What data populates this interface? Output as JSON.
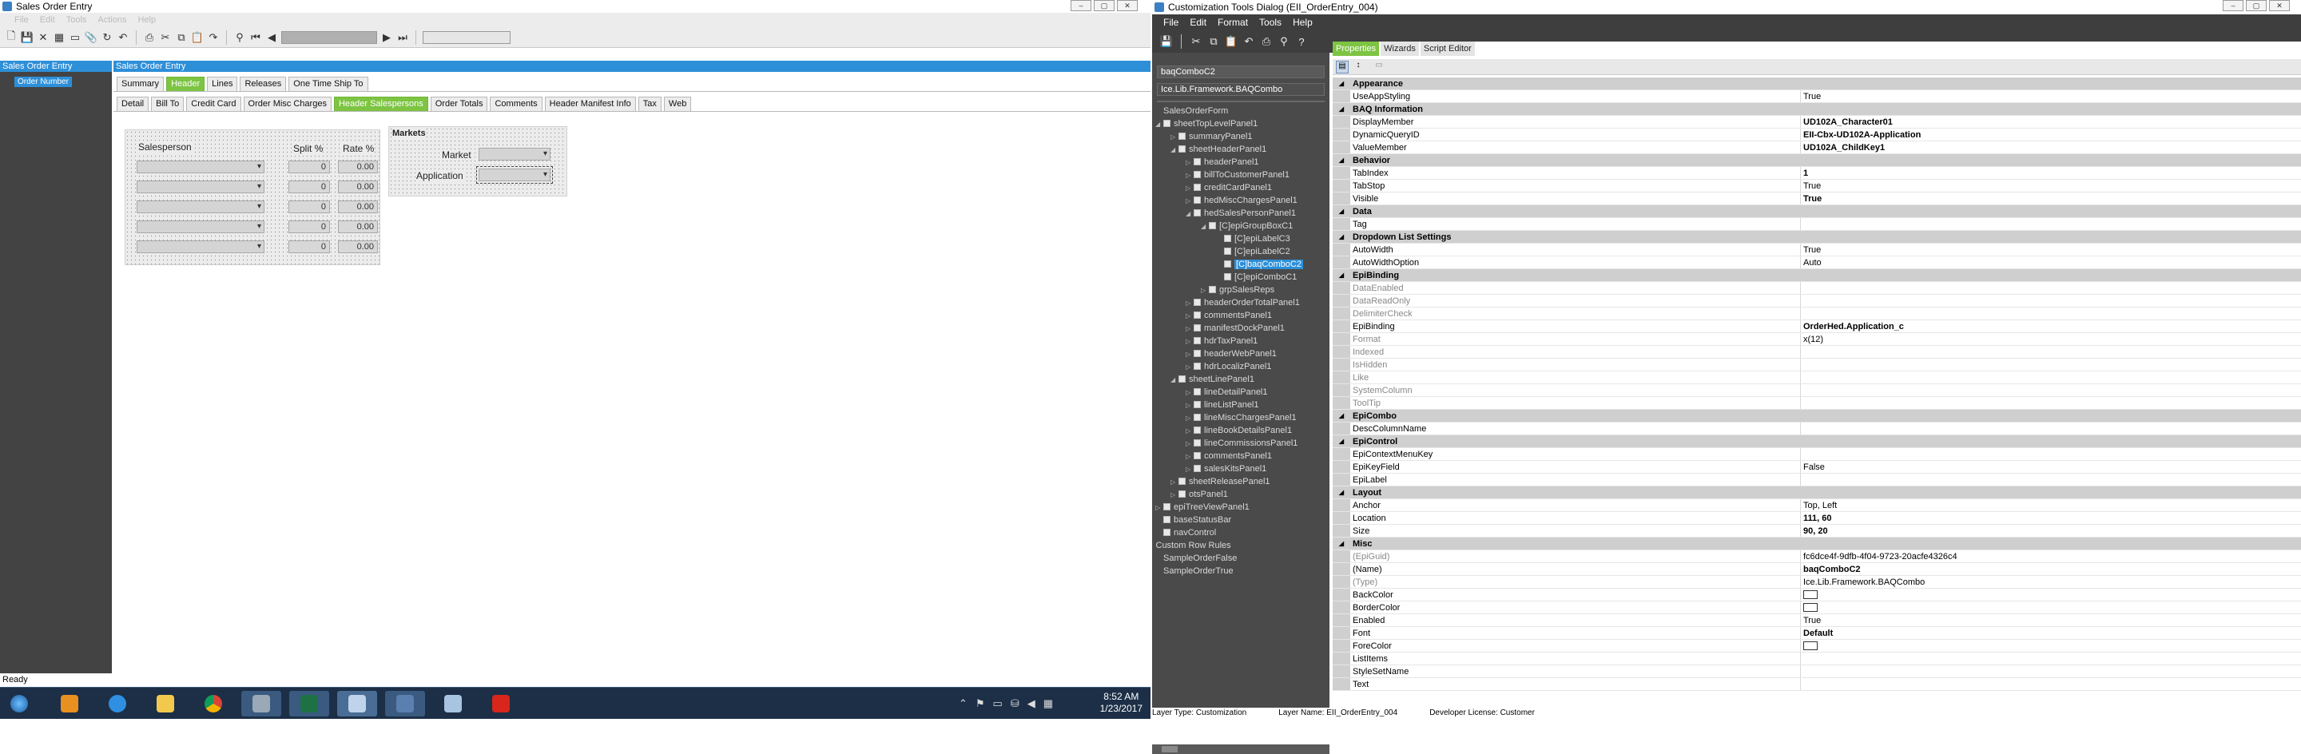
{
  "left": {
    "title": "Sales Order Entry",
    "menu": [
      "File",
      "Edit",
      "Tools",
      "Actions",
      "Help"
    ],
    "nav_pane_title": "Sales Order Entry",
    "order_number_label": "Order Number",
    "main_pane_title": "Sales Order Entry",
    "tabs": [
      "Summary",
      "Header",
      "Lines",
      "Releases",
      "One Time Ship To"
    ],
    "subtabs": [
      "Detail",
      "Bill To",
      "Credit Card",
      "Order Misc Charges",
      "Header Salespersons",
      "Order Totals",
      "Comments",
      "Header Manifest Info",
      "Tax",
      "Web"
    ],
    "salesperson_header": "Salesperson",
    "split_header": "Split %",
    "rate_header": "Rate %",
    "rows": [
      {
        "split": "0",
        "rate": "0.00"
      },
      {
        "split": "0",
        "rate": "0.00"
      },
      {
        "split": "0",
        "rate": "0.00"
      },
      {
        "split": "0",
        "rate": "0.00"
      },
      {
        "split": "0",
        "rate": "0.00"
      }
    ],
    "markets_title": "Markets",
    "market_label": "Market",
    "application_label": "Application",
    "status": "Ready"
  },
  "taskbar": {
    "time": "8:52 AM",
    "date": "1/23/2017",
    "apps": [
      "windows-start-icon",
      "explorer-app-icon",
      "internet-explorer-icon",
      "file-explorer-icon",
      "chrome-icon",
      "tools-app-icon",
      "excel-icon",
      "epicor-app-icon",
      "app-icon",
      "notepad-app-icon",
      "acrobat-icon"
    ]
  },
  "right": {
    "title": "Customization Tools Dialog",
    "title_suffix": "(EII_OrderEntry_004)",
    "menu": [
      "File",
      "Edit",
      "Format",
      "Tools",
      "Help"
    ],
    "tree_header": "baqComboC2",
    "tree_type": "Ice.Lib.Framework.BAQCombo",
    "tree": [
      {
        "label": "SalesOrderForm",
        "depth": 0,
        "exp": "",
        "box": false
      },
      {
        "label": "sheetTopLevelPanel1",
        "depth": 0,
        "exp": "◢",
        "box": true
      },
      {
        "label": "summaryPanel1",
        "depth": 1,
        "exp": "▷",
        "box": true
      },
      {
        "label": "sheetHeaderPanel1",
        "depth": 1,
        "exp": "◢",
        "box": true
      },
      {
        "label": "headerPanel1",
        "depth": 2,
        "exp": "▷",
        "box": true
      },
      {
        "label": "billToCustomerPanel1",
        "depth": 2,
        "exp": "▷",
        "box": true
      },
      {
        "label": "creditCardPanel1",
        "depth": 2,
        "exp": "▷",
        "box": true
      },
      {
        "label": "hedMiscChargesPanel1",
        "depth": 2,
        "exp": "▷",
        "box": true
      },
      {
        "label": "hedSalesPersonPanel1",
        "depth": 2,
        "exp": "◢",
        "box": true
      },
      {
        "label": "[C]epiGroupBoxC1",
        "depth": 3,
        "exp": "◢",
        "box": true
      },
      {
        "label": "[C]epiLabelC3",
        "depth": 4,
        "exp": "",
        "box": true
      },
      {
        "label": "[C]epiLabelC2",
        "depth": 4,
        "exp": "",
        "box": true
      },
      {
        "label": "[C]baqComboC2",
        "depth": 4,
        "exp": "",
        "box": true,
        "selected": true
      },
      {
        "label": "[C]epiComboC1",
        "depth": 4,
        "exp": "",
        "box": true
      },
      {
        "label": "grpSalesReps",
        "depth": 3,
        "exp": "▷",
        "box": true
      },
      {
        "label": "headerOrderTotalPanel1",
        "depth": 2,
        "exp": "▷",
        "box": true
      },
      {
        "label": "commentsPanel1",
        "depth": 2,
        "exp": "▷",
        "box": true
      },
      {
        "label": "manifestDockPanel1",
        "depth": 2,
        "exp": "▷",
        "box": true
      },
      {
        "label": "hdrTaxPanel1",
        "depth": 2,
        "exp": "▷",
        "box": true
      },
      {
        "label": "headerWebPanel1",
        "depth": 2,
        "exp": "▷",
        "box": true
      },
      {
        "label": "hdrLocalizPanel1",
        "depth": 2,
        "exp": "▷",
        "box": true
      },
      {
        "label": "sheetLinePanel1",
        "depth": 1,
        "exp": "◢",
        "box": true
      },
      {
        "label": "lineDetailPanel1",
        "depth": 2,
        "exp": "▷",
        "box": true
      },
      {
        "label": "lineListPanel1",
        "depth": 2,
        "exp": "▷",
        "box": true
      },
      {
        "label": "lineMiscChargesPanel1",
        "depth": 2,
        "exp": "▷",
        "box": true
      },
      {
        "label": "lineBookDetailsPanel1",
        "depth": 2,
        "exp": "▷",
        "box": true
      },
      {
        "label": "lineCommissionsPanel1",
        "depth": 2,
        "exp": "▷",
        "box": true
      },
      {
        "label": "commentsPanel1",
        "depth": 2,
        "exp": "▷",
        "box": true
      },
      {
        "label": "salesKitsPanel1",
        "depth": 2,
        "exp": "▷",
        "box": true
      },
      {
        "label": "sheetReleasePanel1",
        "depth": 1,
        "exp": "▷",
        "box": true
      },
      {
        "label": "otsPanel1",
        "depth": 1,
        "exp": "▷",
        "box": true
      },
      {
        "label": "epiTreeViewPanel1",
        "depth": 0,
        "exp": "▷",
        "box": true
      },
      {
        "label": "baseStatusBar",
        "depth": 0,
        "exp": "",
        "box": true
      },
      {
        "label": "navControl",
        "depth": 0,
        "exp": "",
        "box": true
      },
      {
        "label": "Custom Row Rules",
        "depth": -1,
        "exp": "",
        "box": false
      },
      {
        "label": "SampleOrderFalse",
        "depth": 0,
        "exp": "",
        "box": false
      },
      {
        "label": "SampleOrderTrue",
        "depth": 0,
        "exp": "",
        "box": false
      }
    ],
    "tabs": [
      "Properties",
      "Wizards",
      "Script Editor"
    ],
    "props": [
      {
        "cat": "Appearance"
      },
      {
        "n": "UseAppStyling",
        "v": "True"
      },
      {
        "cat": "BAQ Information"
      },
      {
        "n": "DisplayMember",
        "v": "UD102A_Character01",
        "b": true
      },
      {
        "n": "DynamicQueryID",
        "v": "EII-Cbx-UD102A-Application",
        "b": true
      },
      {
        "n": "ValueMember",
        "v": "UD102A_ChildKey1",
        "b": true
      },
      {
        "cat": "Behavior"
      },
      {
        "n": "TabIndex",
        "v": "1",
        "b": true
      },
      {
        "n": "TabStop",
        "v": "True"
      },
      {
        "n": "Visible",
        "v": "True",
        "b": true
      },
      {
        "cat": "Data"
      },
      {
        "n": "Tag",
        "v": ""
      },
      {
        "cat": "Dropdown List Settings"
      },
      {
        "n": "AutoWidth",
        "v": "True"
      },
      {
        "n": "AutoWidthOption",
        "v": "Auto"
      },
      {
        "cat": "EpiBinding"
      },
      {
        "n": "DataEnabled",
        "v": "",
        "d": true
      },
      {
        "n": "DataReadOnly",
        "v": "",
        "d": true
      },
      {
        "n": "DelimiterCheck",
        "v": "",
        "d": true
      },
      {
        "n": "EpiBinding",
        "v": "OrderHed.Application_c",
        "b": true
      },
      {
        "n": "Format",
        "v": "x(12)",
        "d": true
      },
      {
        "n": "Indexed",
        "v": "",
        "d": true
      },
      {
        "n": "IsHidden",
        "v": "",
        "d": true
      },
      {
        "n": "Like",
        "v": "",
        "d": true
      },
      {
        "n": "SystemColumn",
        "v": "",
        "d": true
      },
      {
        "n": "ToolTip",
        "v": "",
        "d": true
      },
      {
        "cat": "EpiCombo"
      },
      {
        "n": "DescColumnName",
        "v": ""
      },
      {
        "cat": "EpiControl"
      },
      {
        "n": "EpiContextMenuKey",
        "v": ""
      },
      {
        "n": "EpiKeyField",
        "v": "False"
      },
      {
        "n": "EpiLabel",
        "v": ""
      },
      {
        "cat": "Layout"
      },
      {
        "n": "Anchor",
        "v": "Top, Left"
      },
      {
        "n": "Location",
        "v": "111, 60",
        "b": true
      },
      {
        "n": "Size",
        "v": "90, 20",
        "b": true
      },
      {
        "cat": "Misc"
      },
      {
        "n": "(EpiGuid)",
        "v": "fc6dce4f-9dfb-4f04-9723-20acfe4326c4",
        "d": true
      },
      {
        "n": "(Name)",
        "v": "baqComboC2",
        "b": true
      },
      {
        "n": "(Type)",
        "v": "Ice.Lib.Framework.BAQCombo",
        "d": true
      },
      {
        "n": "BackColor",
        "v": "",
        "color": true
      },
      {
        "n": "BorderColor",
        "v": "",
        "color": true
      },
      {
        "n": "Enabled",
        "v": "True"
      },
      {
        "n": "Font",
        "v": "Default",
        "b": true
      },
      {
        "n": "ForeColor",
        "v": "",
        "color": true
      },
      {
        "n": "ListItems",
        "v": ""
      },
      {
        "n": "StyleSetName",
        "v": ""
      },
      {
        "n": "Text",
        "v": ""
      }
    ],
    "status": {
      "layer_type": "Layer Type:  Customization",
      "layer_name": "Layer Name:  EII_OrderEntry_004",
      "license": "Developer License:  Customer"
    }
  },
  "colors": {
    "accent_blue": "#2d8fd8",
    "accent_green": "#7dc442",
    "dark_panel": "#3e3e3e"
  }
}
